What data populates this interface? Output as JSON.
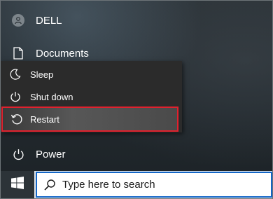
{
  "rail": {
    "user_label": "DELL",
    "documents_label": "Documents",
    "power_label": "Power"
  },
  "power_menu": {
    "items": [
      {
        "label": "Sleep",
        "icon": "moon-icon"
      },
      {
        "label": "Shut down",
        "icon": "power-icon"
      },
      {
        "label": "Restart",
        "icon": "restart-icon",
        "highlighted": true
      }
    ],
    "highlight_color": "#e0212e"
  },
  "taskbar": {
    "search_placeholder": "Type here to search",
    "accent": "#1366c7"
  }
}
